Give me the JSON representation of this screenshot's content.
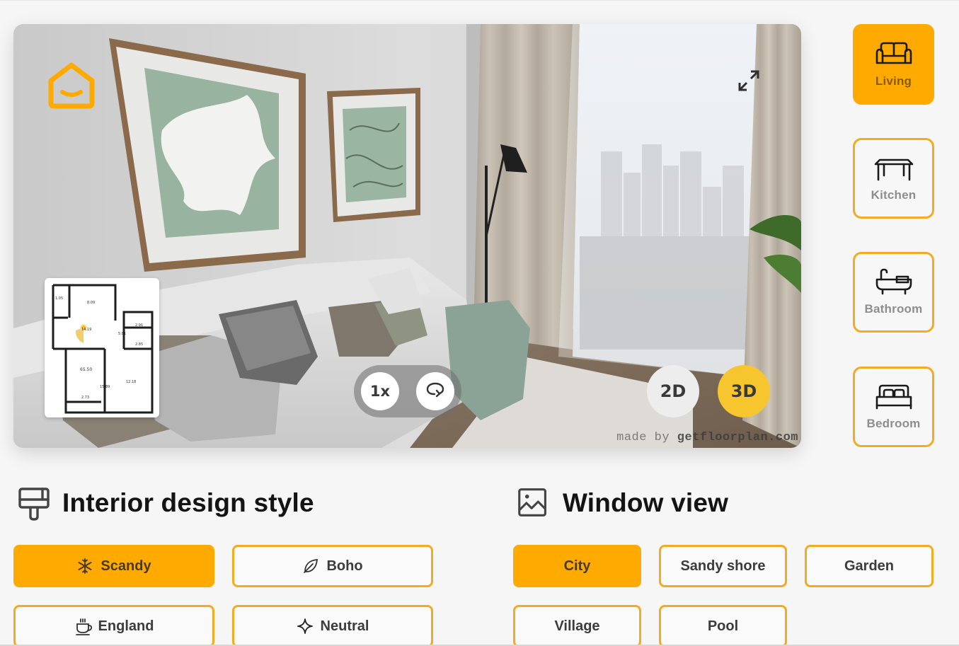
{
  "viewer": {
    "minimap": {
      "room_areas": [
        "1.05",
        "8.09",
        "14.19",
        "5.81",
        "2.91",
        "2.85",
        "65.50",
        "15.89",
        "12.18",
        "2.73"
      ]
    },
    "speed_label": "1x",
    "rotate_icon": "rotate-icon",
    "modes": [
      {
        "label": "2D",
        "active": false
      },
      {
        "label": "3D",
        "active": true
      }
    ],
    "watermark_prefix": "made by ",
    "watermark_site": "getfloorplan.com",
    "expand_icon": "expand-icon",
    "logo_icon": "home-smile-logo"
  },
  "rooms": [
    {
      "label": "Living",
      "icon": "sofa-icon",
      "active": true
    },
    {
      "label": "Kitchen",
      "icon": "table-icon",
      "active": false
    },
    {
      "label": "Bathroom",
      "icon": "bathtub-icon",
      "active": false
    },
    {
      "label": "Bedroom",
      "icon": "bed-icon",
      "active": false
    }
  ],
  "interior": {
    "title": "Interior design style",
    "icon": "paint-brush-icon",
    "options": [
      {
        "label": "Scandy",
        "icon": "snowflake-icon",
        "active": true
      },
      {
        "label": "Boho",
        "icon": "leaf-icon",
        "active": false
      },
      {
        "label": "England",
        "icon": "tea-cup-icon",
        "active": false
      },
      {
        "label": "Neutral",
        "icon": "sparkle-icon",
        "active": false
      }
    ]
  },
  "window_view": {
    "title": "Window view",
    "icon": "image-icon",
    "options": [
      {
        "label": "City",
        "active": true
      },
      {
        "label": "Sandy shore",
        "active": false
      },
      {
        "label": "Garden",
        "active": false
      },
      {
        "label": "Village",
        "active": false
      },
      {
        "label": "Pool",
        "active": false
      }
    ]
  },
  "colors": {
    "accent": "#ffaa00",
    "accent_border": "#f2ac22",
    "mode_active": "#f7c52e"
  }
}
